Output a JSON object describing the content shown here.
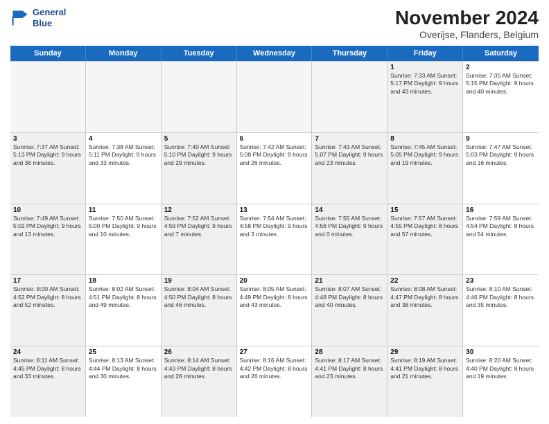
{
  "logo": {
    "line1": "General",
    "line2": "Blue"
  },
  "title": "November 2024",
  "subtitle": "Overijse, Flanders, Belgium",
  "days_of_week": [
    "Sunday",
    "Monday",
    "Tuesday",
    "Wednesday",
    "Thursday",
    "Friday",
    "Saturday"
  ],
  "weeks": [
    [
      {
        "day": "",
        "info": "",
        "empty": true
      },
      {
        "day": "",
        "info": "",
        "empty": true
      },
      {
        "day": "",
        "info": "",
        "empty": true
      },
      {
        "day": "",
        "info": "",
        "empty": true
      },
      {
        "day": "",
        "info": "",
        "empty": true
      },
      {
        "day": "1",
        "info": "Sunrise: 7:33 AM\nSunset: 5:17 PM\nDaylight: 9 hours and 43 minutes.",
        "empty": false,
        "shaded": true
      },
      {
        "day": "2",
        "info": "Sunrise: 7:35 AM\nSunset: 5:15 PM\nDaylight: 9 hours and 40 minutes.",
        "empty": false
      }
    ],
    [
      {
        "day": "3",
        "info": "Sunrise: 7:37 AM\nSunset: 5:13 PM\nDaylight: 9 hours and 36 minutes.",
        "empty": false,
        "shaded": true
      },
      {
        "day": "4",
        "info": "Sunrise: 7:38 AM\nSunset: 5:11 PM\nDaylight: 9 hours and 33 minutes.",
        "empty": false
      },
      {
        "day": "5",
        "info": "Sunrise: 7:40 AM\nSunset: 5:10 PM\nDaylight: 9 hours and 29 minutes.",
        "empty": false,
        "shaded": true
      },
      {
        "day": "6",
        "info": "Sunrise: 7:42 AM\nSunset: 5:08 PM\nDaylight: 9 hours and 26 minutes.",
        "empty": false
      },
      {
        "day": "7",
        "info": "Sunrise: 7:43 AM\nSunset: 5:07 PM\nDaylight: 9 hours and 23 minutes.",
        "empty": false,
        "shaded": true
      },
      {
        "day": "8",
        "info": "Sunrise: 7:45 AM\nSunset: 5:05 PM\nDaylight: 9 hours and 19 minutes.",
        "empty": false,
        "shaded": true
      },
      {
        "day": "9",
        "info": "Sunrise: 7:47 AM\nSunset: 5:03 PM\nDaylight: 9 hours and 16 minutes.",
        "empty": false
      }
    ],
    [
      {
        "day": "10",
        "info": "Sunrise: 7:49 AM\nSunset: 5:02 PM\nDaylight: 9 hours and 13 minutes.",
        "empty": false,
        "shaded": true
      },
      {
        "day": "11",
        "info": "Sunrise: 7:50 AM\nSunset: 5:00 PM\nDaylight: 9 hours and 10 minutes.",
        "empty": false
      },
      {
        "day": "12",
        "info": "Sunrise: 7:52 AM\nSunset: 4:59 PM\nDaylight: 9 hours and 7 minutes.",
        "empty": false,
        "shaded": true
      },
      {
        "day": "13",
        "info": "Sunrise: 7:54 AM\nSunset: 4:58 PM\nDaylight: 9 hours and 3 minutes.",
        "empty": false
      },
      {
        "day": "14",
        "info": "Sunrise: 7:55 AM\nSunset: 4:56 PM\nDaylight: 9 hours and 0 minutes.",
        "empty": false,
        "shaded": true
      },
      {
        "day": "15",
        "info": "Sunrise: 7:57 AM\nSunset: 4:55 PM\nDaylight: 8 hours and 57 minutes.",
        "empty": false,
        "shaded": true
      },
      {
        "day": "16",
        "info": "Sunrise: 7:59 AM\nSunset: 4:54 PM\nDaylight: 8 hours and 54 minutes.",
        "empty": false
      }
    ],
    [
      {
        "day": "17",
        "info": "Sunrise: 8:00 AM\nSunset: 4:52 PM\nDaylight: 8 hours and 52 minutes.",
        "empty": false,
        "shaded": true
      },
      {
        "day": "18",
        "info": "Sunrise: 8:02 AM\nSunset: 4:51 PM\nDaylight: 8 hours and 49 minutes.",
        "empty": false
      },
      {
        "day": "19",
        "info": "Sunrise: 8:04 AM\nSunset: 4:50 PM\nDaylight: 8 hours and 46 minutes.",
        "empty": false,
        "shaded": true
      },
      {
        "day": "20",
        "info": "Sunrise: 8:05 AM\nSunset: 4:49 PM\nDaylight: 8 hours and 43 minutes.",
        "empty": false
      },
      {
        "day": "21",
        "info": "Sunrise: 8:07 AM\nSunset: 4:48 PM\nDaylight: 8 hours and 40 minutes.",
        "empty": false,
        "shaded": true
      },
      {
        "day": "22",
        "info": "Sunrise: 8:08 AM\nSunset: 4:47 PM\nDaylight: 8 hours and 38 minutes.",
        "empty": false,
        "shaded": true
      },
      {
        "day": "23",
        "info": "Sunrise: 8:10 AM\nSunset: 4:46 PM\nDaylight: 8 hours and 35 minutes.",
        "empty": false
      }
    ],
    [
      {
        "day": "24",
        "info": "Sunrise: 8:11 AM\nSunset: 4:45 PM\nDaylight: 8 hours and 33 minutes.",
        "empty": false,
        "shaded": true
      },
      {
        "day": "25",
        "info": "Sunrise: 8:13 AM\nSunset: 4:44 PM\nDaylight: 8 hours and 30 minutes.",
        "empty": false
      },
      {
        "day": "26",
        "info": "Sunrise: 8:14 AM\nSunset: 4:43 PM\nDaylight: 8 hours and 28 minutes.",
        "empty": false,
        "shaded": true
      },
      {
        "day": "27",
        "info": "Sunrise: 8:16 AM\nSunset: 4:42 PM\nDaylight: 8 hours and 26 minutes.",
        "empty": false
      },
      {
        "day": "28",
        "info": "Sunrise: 8:17 AM\nSunset: 4:41 PM\nDaylight: 8 hours and 23 minutes.",
        "empty": false,
        "shaded": true
      },
      {
        "day": "29",
        "info": "Sunrise: 8:19 AM\nSunset: 4:41 PM\nDaylight: 8 hours and 21 minutes.",
        "empty": false,
        "shaded": true
      },
      {
        "day": "30",
        "info": "Sunrise: 8:20 AM\nSunset: 4:40 PM\nDaylight: 8 hours and 19 minutes.",
        "empty": false
      }
    ]
  ]
}
